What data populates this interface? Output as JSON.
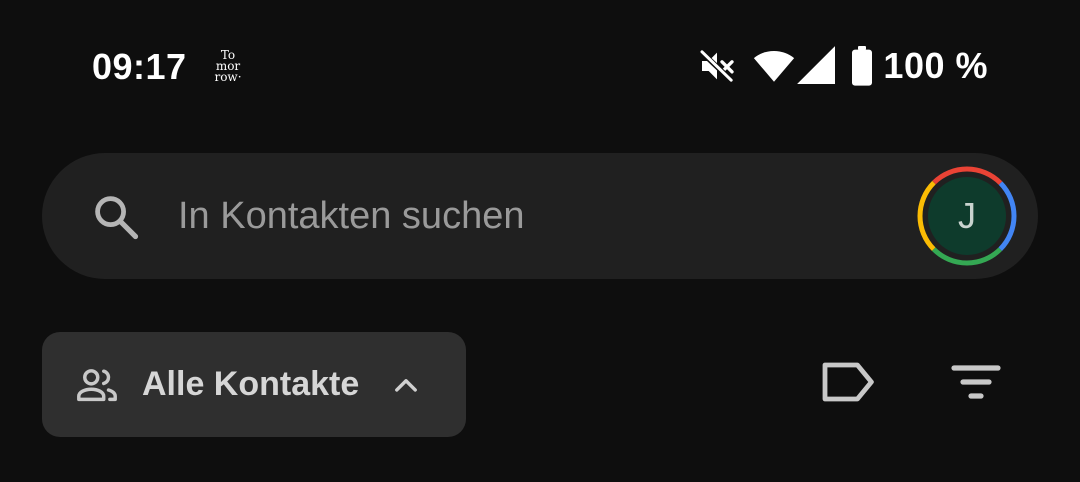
{
  "status_bar": {
    "time": "09:17",
    "app_logo_lines": [
      "To",
      "mor",
      "row·"
    ],
    "icons": [
      "mute-icon",
      "wifi-icon",
      "signal-icon",
      "battery-icon"
    ],
    "battery_percent": "100 %"
  },
  "search": {
    "placeholder": "In Kontakten suchen",
    "value": "",
    "icon": "search-icon"
  },
  "account": {
    "avatar_initial": "J",
    "avatar_bg": "#0e3b2c",
    "ring_colors": [
      "#ea4335",
      "#4285f4",
      "#34a853",
      "#fbbc04"
    ]
  },
  "filter_row": {
    "chip_label": "Alle Kontakte",
    "chip_icon": "people-icon",
    "chip_chevron": "chevron-up-icon",
    "label_icon": "label-icon",
    "filter_icon": "filter-icon"
  },
  "colors": {
    "background": "#0e0e0e",
    "search_bar": "#202020",
    "chip": "#2f2f2f"
  }
}
